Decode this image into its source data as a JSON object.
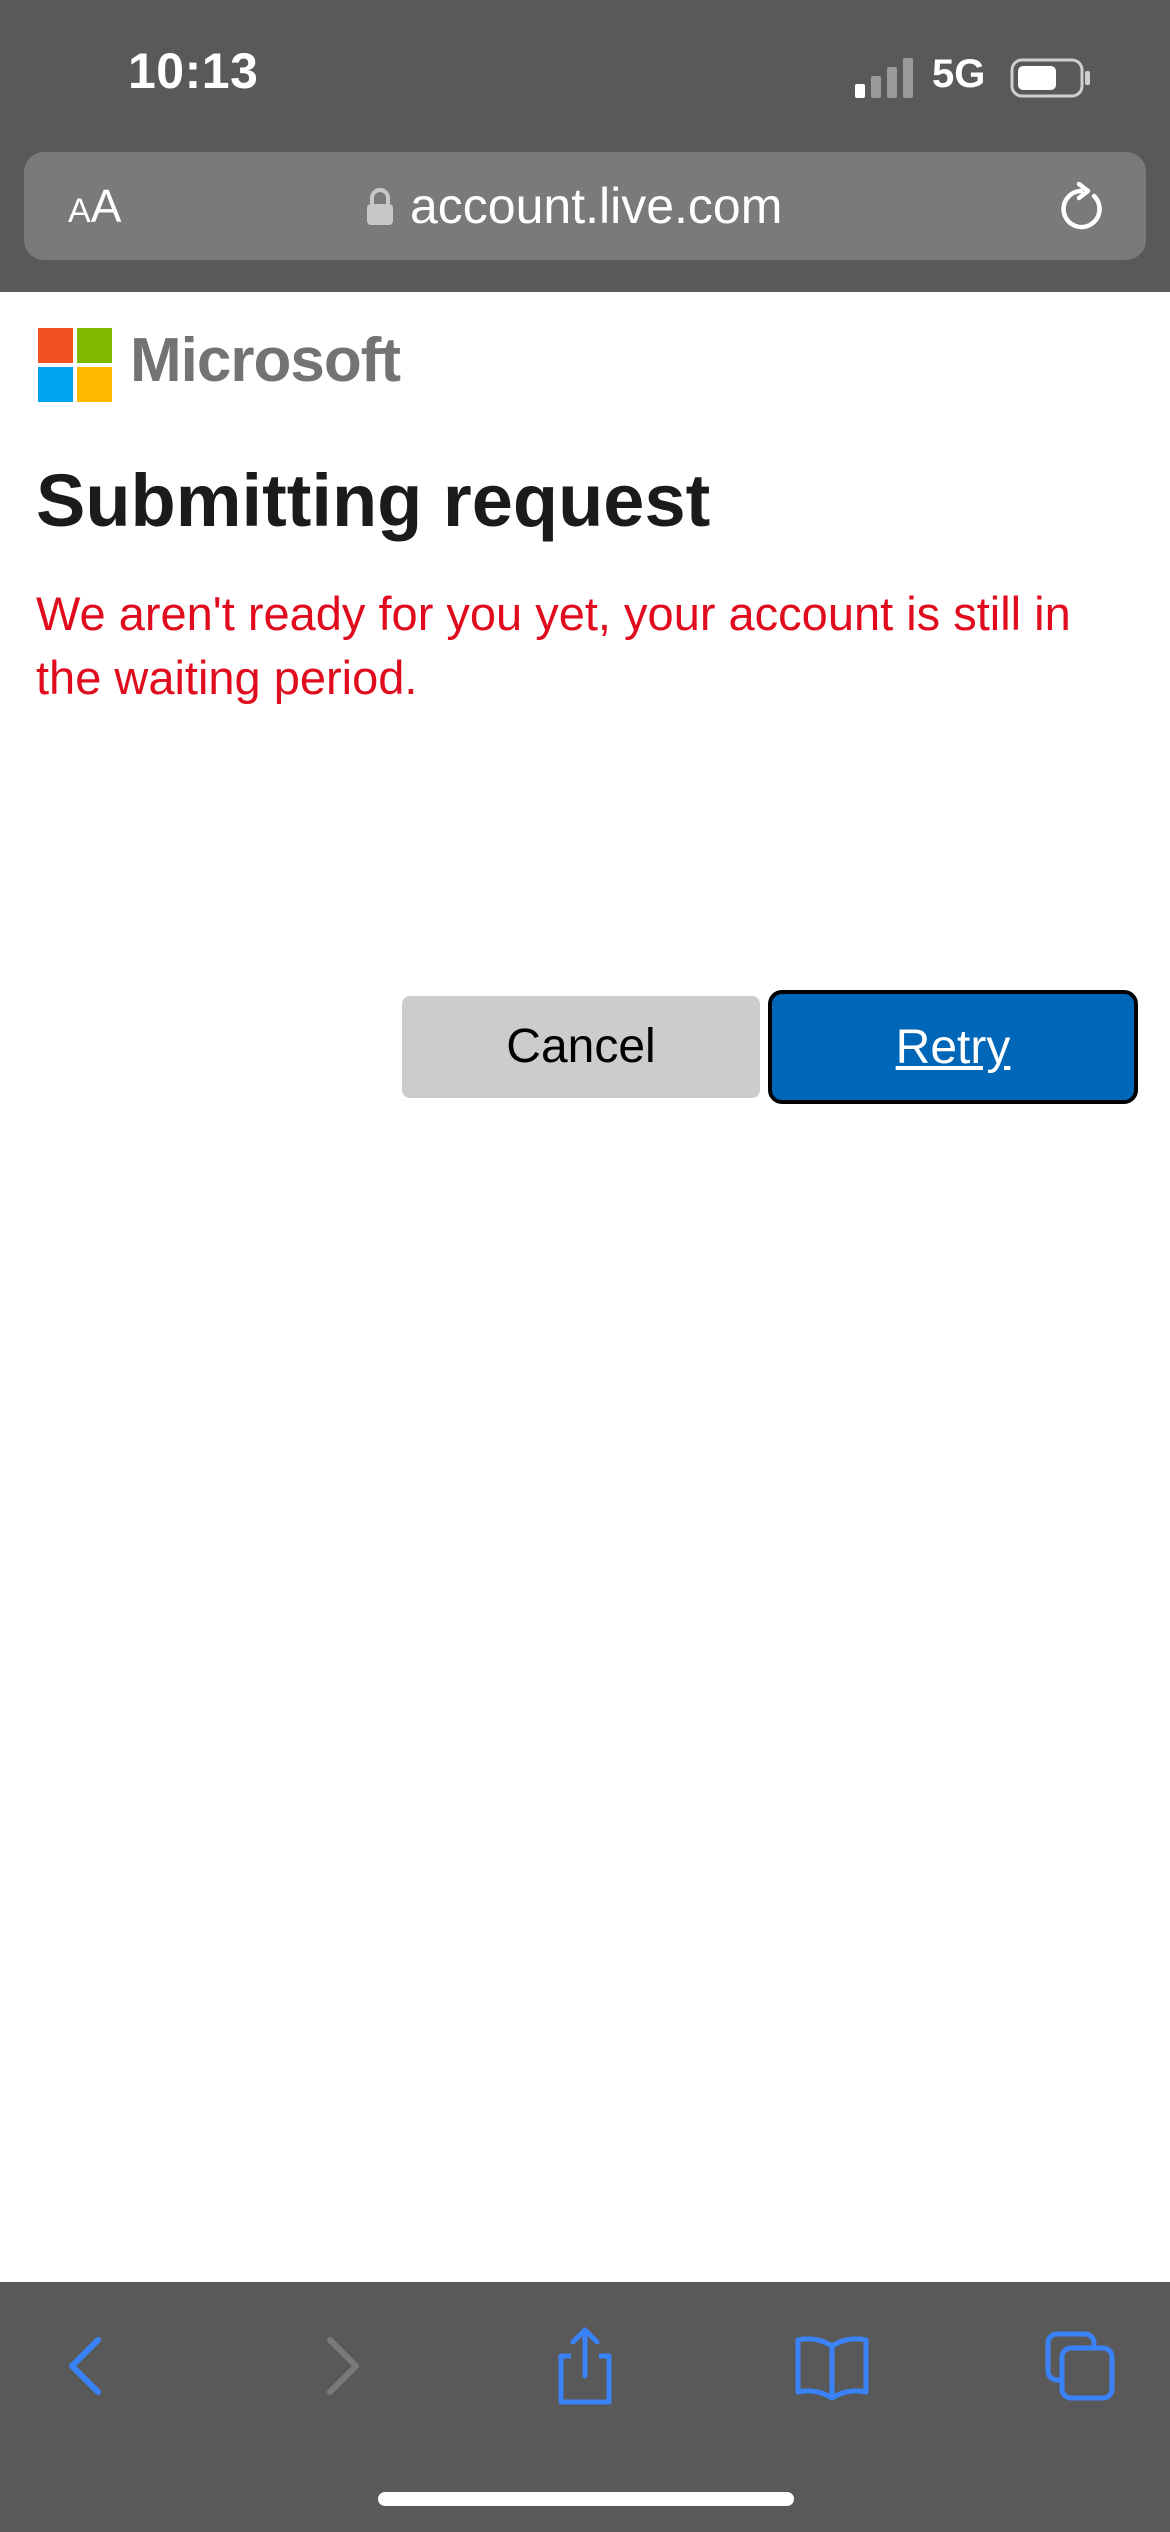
{
  "status_bar": {
    "time": "10:13",
    "network": "5G",
    "icons": [
      "cellular-signal-icon",
      "battery-icon"
    ]
  },
  "browser": {
    "text_size_small": "A",
    "text_size_large": "A",
    "url": "account.live.com",
    "icons": [
      "lock-icon",
      "reload-icon"
    ]
  },
  "page": {
    "brand": "Microsoft",
    "title": "Submitting request",
    "error_message": "We aren't ready for you yet, your account is still in the waiting period.",
    "cancel_label": "Cancel",
    "retry_label": "Retry"
  },
  "toolbar": {
    "icons": [
      "back-icon",
      "forward-icon",
      "share-icon",
      "bookmarks-icon",
      "tabs-icon"
    ]
  },
  "colors": {
    "chrome": "#595959",
    "accent_blue": "#0067b8",
    "error_red": "#e00b1c",
    "logo": [
      "#f25022",
      "#7fba00",
      "#00a4ef",
      "#ffb900"
    ],
    "toolbar_icon": "#3a82f7"
  }
}
